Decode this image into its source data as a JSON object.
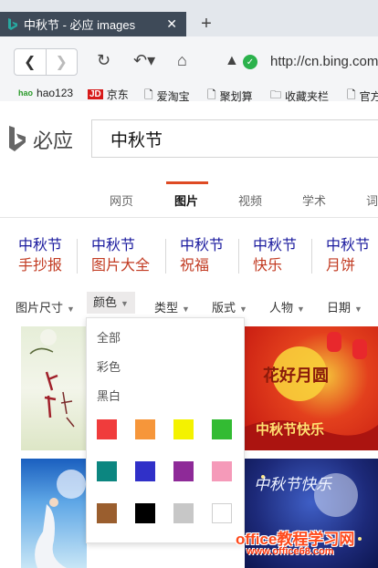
{
  "browser": {
    "tab_title": "中秋节 - 必应 images",
    "new_tab": "+",
    "tab_close": "✕",
    "url": "http://cn.bing.com",
    "icons": [
      "back-icon",
      "forward-icon",
      "refresh-icon",
      "undo-icon",
      "home-icon",
      "triangle-icon",
      "shield-icon"
    ]
  },
  "bookmarks": [
    "hao123",
    "京东",
    "爱淘宝",
    "聚划算",
    "收藏夹栏",
    "官方"
  ],
  "bing": {
    "logo_text": "必应",
    "query": "中秋节"
  },
  "categories": [
    "网页",
    "图片",
    "视频",
    "学术",
    "词"
  ],
  "related": [
    {
      "l1": "中秋节",
      "l2": "手抄报"
    },
    {
      "l1": "中秋节",
      "l2": "图片大全"
    },
    {
      "l1": "中秋节",
      "l2": "祝福"
    },
    {
      "l1": "中秋节",
      "l2": "快乐"
    },
    {
      "l1": "中秋节",
      "l2": "月饼"
    }
  ],
  "filters": [
    "图片尺寸",
    "颜色",
    "类型",
    "版式",
    "人物",
    "日期"
  ],
  "color_menu": {
    "options": [
      "全部",
      "彩色",
      "黑白"
    ],
    "swatches": [
      "#f03c3c",
      "#f6963a",
      "#f4f200",
      "#33bb33",
      "#0c8680",
      "#3030c8",
      "#8e2a98",
      "#f59ab9",
      "#9a5e2e",
      "#000000",
      "#c7c7c7",
      "#ffffff"
    ]
  },
  "images": {
    "tile2_text1": "花好月圆",
    "tile2_text2": "中秋节快乐",
    "tile4_text": "中秋节快乐"
  },
  "watermark": {
    "line1": "office教程学习网",
    "line2": "www.office68.com"
  }
}
